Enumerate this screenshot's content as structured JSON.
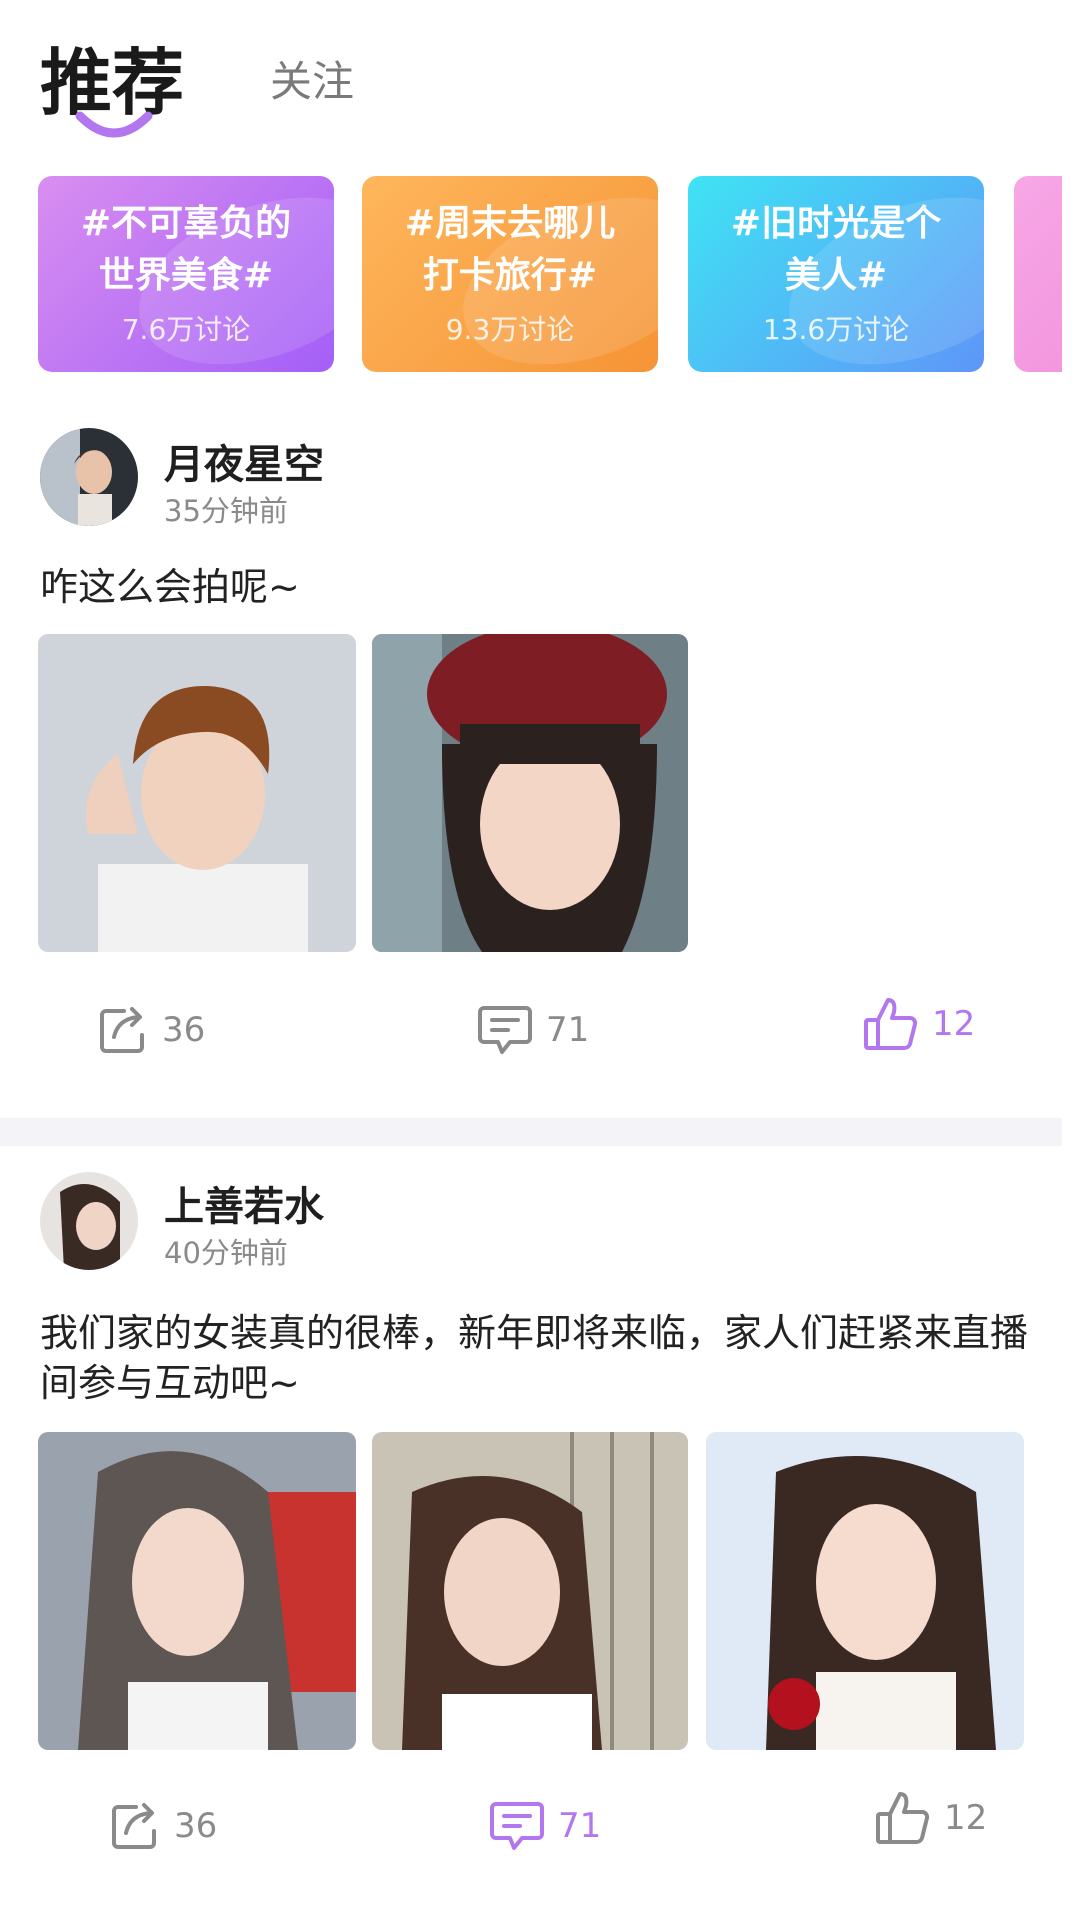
{
  "tabs": {
    "recommend": "推荐",
    "follow": "关注"
  },
  "topics": [
    {
      "title_line1": "#不可辜负的",
      "title_line2": "世界美食#",
      "count": "7.6万讨论",
      "gradient": [
        "#d28cf0",
        "#a864f6"
      ]
    },
    {
      "title_line1": "#周末去哪儿",
      "title_line2": "打卡旅行#",
      "count": "9.3万讨论",
      "gradient": [
        "#fdb257",
        "#f69a3a"
      ]
    },
    {
      "title_line1": "#旧时光是个",
      "title_line2": "美人#",
      "count": "13.6万讨论",
      "gradient": [
        "#3fe0f4",
        "#5d9cf8"
      ]
    }
  ],
  "posts": [
    {
      "author": "月夜星空",
      "time": "35分钟前",
      "text": "咋这么会拍呢~",
      "actions": {
        "share": "36",
        "comment": "71",
        "like": "12"
      }
    },
    {
      "author": "上善若水",
      "time": "40分钟前",
      "text": "我们家的女装真的很棒，新年即将来临，家人们赶紧来直播间参与互动吧~",
      "actions": {
        "share": "36",
        "comment": "71",
        "like": "12"
      }
    }
  ],
  "colors": {
    "accent": "#b277ee",
    "muted": "#8a8a8a",
    "separator": "#f4f4f8",
    "peek_card": "#f59ae0"
  },
  "icons": [
    "share-icon",
    "comment-icon",
    "thumbs-up-icon"
  ]
}
